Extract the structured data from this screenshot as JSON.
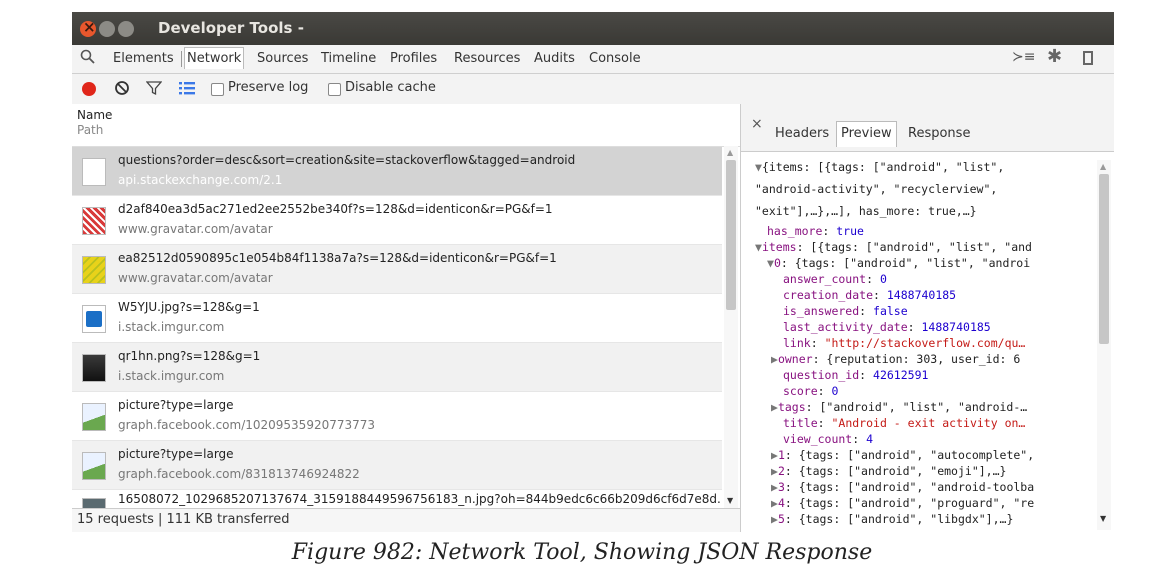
{
  "window": {
    "title": "Developer Tools -"
  },
  "tabs": [
    "Elements",
    "Network",
    "Sources",
    "Timeline",
    "Profiles",
    "Resources",
    "Audits",
    "Console"
  ],
  "controls": {
    "preserve_log": "Preserve log",
    "disable_cache": "Disable cache"
  },
  "columns": {
    "name": "Name",
    "path": "Path"
  },
  "requests": [
    {
      "name": "questions?order=desc&sort=creation&site=stackoverflow&tagged=android",
      "host": "api.stackexchange.com/2.1",
      "icon": "document-icon"
    },
    {
      "name": "d2af840ea3d5ac271ed2ee2552be340f?s=128&d=identicon&r=PG&f=1",
      "host": "www.gravatar.com/avatar",
      "icon": "identicon-red-icon"
    },
    {
      "name": "ea82512d0590895c1e054b84f1138a7a?s=128&d=identicon&r=PG&f=1",
      "host": "www.gravatar.com/avatar",
      "icon": "identicon-yellow-icon"
    },
    {
      "name": "W5YJU.jpg?s=128&g=1",
      "host": "i.stack.imgur.com",
      "icon": "blue-avatar-icon"
    },
    {
      "name": "qr1hn.png?s=128&g=1",
      "host": "i.stack.imgur.com",
      "icon": "photo-avatar-icon"
    },
    {
      "name": "picture?type=large",
      "host": "graph.facebook.com/10209535920773773",
      "icon": "broken-image-icon"
    },
    {
      "name": "picture?type=large",
      "host": "graph.facebook.com/831813746924822",
      "icon": "broken-image-icon"
    },
    {
      "name": "16508072_1029685207137674_3159188449596756183_n.jpg?oh=844b9edc6c66b209d6cf6d7e8d...",
      "host": "",
      "icon": "image-icon"
    }
  ],
  "status": "15 requests | 111 KB transferred",
  "detail_tabs": [
    "Headers",
    "Preview",
    "Response"
  ],
  "preview": {
    "root1": "{items: [{tags: [\"android\", \"list\",",
    "root2": "\"android-activity\", \"recyclerview\",",
    "root3": "\"exit\"],…},…], has_more: true,…}",
    "has_more_key": "has_more",
    "has_more_val": "true",
    "items_key": "items",
    "items_val": "[{tags: [\"android\", \"list\", \"and",
    "i0_key": "0",
    "i0_val": "{tags: [\"android\", \"list\", \"androi",
    "answer_count_key": "answer_count",
    "answer_count_val": "0",
    "creation_date_key": "creation_date",
    "creation_date_val": "1488740185",
    "is_answered_key": "is_answered",
    "is_answered_val": "false",
    "last_activity_date_key": "last_activity_date",
    "last_activity_date_val": "1488740185",
    "link_key": "link",
    "link_val": "\"http://stackoverflow.com/qu…",
    "owner_key": "owner",
    "owner_val": "{reputation: 303, user_id: 6",
    "question_id_key": "question_id",
    "question_id_val": "42612591",
    "score_key": "score",
    "score_val": "0",
    "tags_key": "tags",
    "tags_val": "[\"android\", \"list\", \"android-…",
    "title_key": "title",
    "title_val": "\"Android - exit activity on…",
    "view_count_key": "view_count",
    "view_count_val": "4",
    "i1_key": "1",
    "i1_val": "{tags: [\"android\", \"autocomplete\",",
    "i2_key": "2",
    "i2_val": "{tags: [\"android\", \"emoji\"],…}",
    "i3_key": "3",
    "i3_val": "{tags: [\"android\", \"android-toolba",
    "i4_key": "4",
    "i4_val": "{tags: [\"android\", \"proguard\", \"re",
    "i5_key": "5",
    "i5_val": "{tags: [\"android\", \"libgdx\"],…}"
  },
  "caption": "Figure 982: Network Tool, Showing JSON Response",
  "colors": {
    "record": "#e0261a",
    "selected_row": "#d3d3d3",
    "titlebar": "#3f3e3a"
  }
}
